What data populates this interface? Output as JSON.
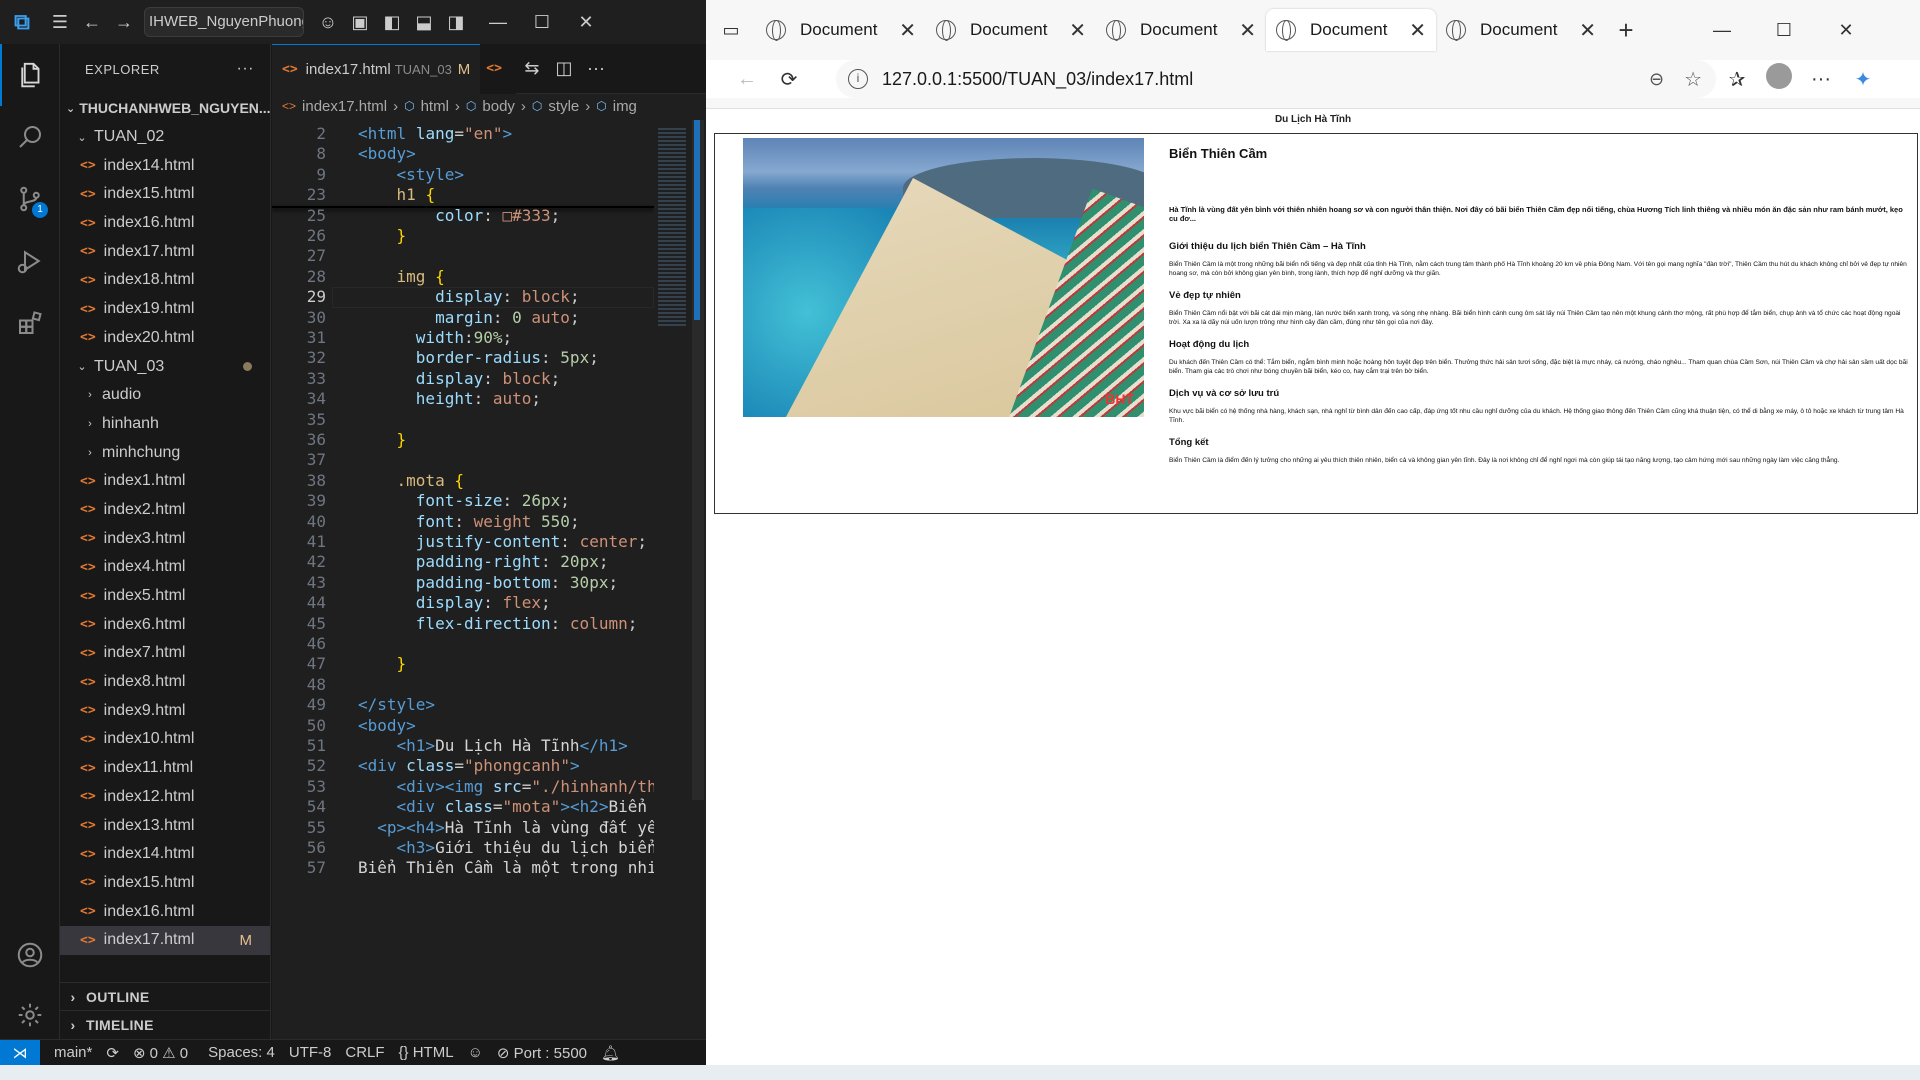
{
  "vscode": {
    "window_title": "IHWEB_NguyenPhuong",
    "explorer_title": "EXPLORER",
    "root_folder": "THUCHANHWEB_NGUYEN...",
    "tree": [
      {
        "label": "TUAN_02",
        "type": "folder",
        "level": 1,
        "open": true
      },
      {
        "label": "index14.html",
        "type": "file",
        "level": 2
      },
      {
        "label": "index15.html",
        "type": "file",
        "level": 2
      },
      {
        "label": "index16.html",
        "type": "file",
        "level": 2
      },
      {
        "label": "index17.html",
        "type": "file",
        "level": 2
      },
      {
        "label": "index18.html",
        "type": "file",
        "level": 2
      },
      {
        "label": "index19.html",
        "type": "file",
        "level": 2
      },
      {
        "label": "index20.html",
        "type": "file",
        "level": 2
      },
      {
        "label": "TUAN_03",
        "type": "folder",
        "level": 1,
        "open": true,
        "dot": true
      },
      {
        "label": "audio",
        "type": "folder",
        "level": 2,
        "open": false
      },
      {
        "label": "hinhanh",
        "type": "folder",
        "level": 2,
        "open": false
      },
      {
        "label": "minhchung",
        "type": "folder",
        "level": 2,
        "open": false
      },
      {
        "label": "index1.html",
        "type": "file",
        "level": 2
      },
      {
        "label": "index2.html",
        "type": "file",
        "level": 2
      },
      {
        "label": "index3.html",
        "type": "file",
        "level": 2
      },
      {
        "label": "index4.html",
        "type": "file",
        "level": 2
      },
      {
        "label": "index5.html",
        "type": "file",
        "level": 2
      },
      {
        "label": "index6.html",
        "type": "file",
        "level": 2
      },
      {
        "label": "index7.html",
        "type": "file",
        "level": 2
      },
      {
        "label": "index8.html",
        "type": "file",
        "level": 2
      },
      {
        "label": "index9.html",
        "type": "file",
        "level": 2
      },
      {
        "label": "index10.html",
        "type": "file",
        "level": 2
      },
      {
        "label": "index11.html",
        "type": "file",
        "level": 2
      },
      {
        "label": "index12.html",
        "type": "file",
        "level": 2
      },
      {
        "label": "index13.html",
        "type": "file",
        "level": 2
      },
      {
        "label": "index14.html",
        "type": "file",
        "level": 2
      },
      {
        "label": "index15.html",
        "type": "file",
        "level": 2
      },
      {
        "label": "index16.html",
        "type": "file",
        "level": 2
      },
      {
        "label": "index17.html",
        "type": "file",
        "level": 2,
        "selected": true,
        "badge": "M"
      }
    ],
    "outline_label": "OUTLINE",
    "timeline_label": "TIMELINE",
    "scm_badge": "1",
    "tab": {
      "name": "index17.html",
      "folder": "TUAN_03",
      "modified": "M"
    },
    "breadcrumb": [
      "index17.html",
      "html",
      "body",
      "style",
      "img"
    ],
    "sticky_lines": [
      {
        "num": "2",
        "html": "<span class='t'>&lt;html</span> <span class='a'>lang</span>=<span class='s'>\"en\"</span><span class='t'>&gt;</span>",
        "indent": 0
      },
      {
        "num": "8",
        "html": "<span class='t'>&lt;body&gt;</span>",
        "indent": 0
      },
      {
        "num": "9",
        "html": "    <span class='t'>&lt;style&gt;</span>",
        "indent": 0
      },
      {
        "num": "23",
        "html": "    <span class='sel2'>h1</span> <span class='br'>{</span>",
        "indent": 0
      }
    ],
    "code_lines": [
      {
        "num": "25",
        "html": "        <span class='p'>color</span>: <span class='v'>□#333</span>;"
      },
      {
        "num": "26",
        "html": "    <span class='br'>}</span>"
      },
      {
        "num": "27",
        "html": ""
      },
      {
        "num": "28",
        "html": "    <span class='sel2'>img</span> <span class='br'>{</span>"
      },
      {
        "num": "29",
        "html": "        <span class='p'>display</span>: <span class='v'>block</span>;",
        "current": true
      },
      {
        "num": "30",
        "html": "        <span class='p'>margin</span>: <span class='n'>0</span> <span class='v'>auto</span>;"
      },
      {
        "num": "31",
        "html": "      <span class='p'>width</span>:<span class='n'>90%</span>;"
      },
      {
        "num": "32",
        "html": "      <span class='p'>border-radius</span>: <span class='n'>5px</span>;"
      },
      {
        "num": "33",
        "html": "      <span class='p'>display</span>: <span class='v'>block</span>;"
      },
      {
        "num": "34",
        "html": "      <span class='p'>height</span>: <span class='v'>auto</span>;"
      },
      {
        "num": "35",
        "html": ""
      },
      {
        "num": "36",
        "html": "    <span class='br'>}</span>"
      },
      {
        "num": "37",
        "html": ""
      },
      {
        "num": "38",
        "html": "    <span class='sel2'>.mota</span> <span class='br'>{</span>"
      },
      {
        "num": "39",
        "html": "      <span class='p'>font-size</span>: <span class='n'>26px</span>;"
      },
      {
        "num": "40",
        "html": "      <span class='p'>font</span>: <span class='v'>weight</span> <span class='n'>550</span>;"
      },
      {
        "num": "41",
        "html": "      <span class='p'>justify-content</span>: <span class='v'>center</span>;"
      },
      {
        "num": "42",
        "html": "      <span class='p'>padding-right</span>: <span class='n'>20px</span>;"
      },
      {
        "num": "43",
        "html": "      <span class='p'>padding-bottom</span>: <span class='n'>30px</span>;"
      },
      {
        "num": "44",
        "html": "      <span class='p'>display</span>: <span class='v'>flex</span>;"
      },
      {
        "num": "45",
        "html": "      <span class='p'>flex-direction</span>: <span class='v'>column</span>;"
      },
      {
        "num": "46",
        "html": ""
      },
      {
        "num": "47",
        "html": "    <span class='br'>}</span>"
      },
      {
        "num": "48",
        "html": ""
      },
      {
        "num": "49",
        "html": "<span class='t'>&lt;/style&gt;</span>"
      },
      {
        "num": "50",
        "html": "<span class='t'>&lt;body&gt;</span>"
      },
      {
        "num": "51",
        "html": "    <span class='t'>&lt;h1&gt;</span><span class='txt'>Du Lịch Hà Tĩnh</span><span class='t'>&lt;/h1&gt;</span>"
      },
      {
        "num": "52",
        "html": "<span class='t'>&lt;div</span> <span class='a'>class</span>=<span class='s'>\"phongcanh\"</span><span class='t'>&gt;</span>"
      },
      {
        "num": "53",
        "html": "    <span class='t'>&lt;div&gt;&lt;img</span> <span class='a'>src</span>=<span class='s'>\"./hinhanh/th</span>"
      },
      {
        "num": "54",
        "html": "    <span class='t'>&lt;div</span> <span class='a'>class</span>=<span class='s'>\"mota\"</span><span class='t'>&gt;&lt;h2&gt;</span><span class='txt'>Biển</span>"
      },
      {
        "num": "55",
        "html": "  <span class='t'>&lt;p&gt;&lt;h4&gt;</span><span class='txt'>Hà Tĩnh là vùng đất yê</span>"
      },
      {
        "num": "56",
        "html": "    <span class='t'>&lt;h3&gt;</span><span class='txt'>Giới thiệu du lịch biển</span>"
      },
      {
        "num": "57",
        "html": "<span class='txt'>Biển Thiên Cầm là một trong nhi</span>"
      }
    ],
    "status": {
      "branch": "main*",
      "problems": "⊗ 0 ⚠ 0",
      "spaces": "Spaces: 4",
      "encoding": "UTF-8",
      "eol": "CRLF",
      "language": "{} HTML",
      "port": "⊘ Port : 5500"
    }
  },
  "browser": {
    "tabs": [
      {
        "label": "Document",
        "active": false
      },
      {
        "label": "Document",
        "active": false
      },
      {
        "label": "Document",
        "active": false
      },
      {
        "label": "Document",
        "active": true
      },
      {
        "label": "Document",
        "active": false
      }
    ],
    "url": "127.0.0.1:5500/TUAN_03/index17.html",
    "page": {
      "h1": "Du Lịch Hà Tĩnh",
      "h2": "Biển Thiên Cầm",
      "intro": "Hà Tĩnh là vùng đất yên bình với thiên nhiên hoang sơ và con người thân thiện. Nơi đây có bãi biển Thiên Cầm đẹp nổi tiếng, chùa Hương Tích linh thiêng và nhiều món ăn đặc sản như ram bánh mướt, kẹo cu đơ...",
      "photo_logo": "BHT",
      "sections": [
        {
          "title": "Giới thiệu du lịch biển Thiên Cầm – Hà Tĩnh",
          "text": "Biển Thiên Cầm là một trong những bãi biển nổi tiếng và đẹp nhất của tỉnh Hà Tĩnh, nằm cách trung tâm thành phố Hà Tĩnh khoảng 20 km về phía Đông Nam. Với tên gọi mang nghĩa \"đàn trời\", Thiên Cầm thu hút du khách không chỉ bởi vẻ đẹp tự nhiên hoang sơ, mà còn bởi không gian yên bình, trong lành, thích hợp để nghỉ dưỡng và thư giãn."
        },
        {
          "title": "Vẻ đẹp tự nhiên",
          "text": "Biển Thiên Cầm nổi bật với bãi cát dài mịn màng, làn nước biển xanh trong, và sóng nhẹ nhàng. Bãi biển hình cánh cung ôm sát lấy núi Thiên Cầm tạo nên một khung cảnh thơ mộng, rất phù hợp để tắm biển, chụp ảnh và tổ chức các hoạt động ngoài trời. Xa xa là dãy núi uốn lượn trông như hình cây đàn cầm, đúng như tên gọi của nơi đây."
        },
        {
          "title": "Hoạt động du lịch",
          "text": "Du khách đến Thiên Cầm có thể: Tắm biển, ngắm bình minh hoặc hoàng hôn tuyệt đẹp trên biển. Thưởng thức hải sản tươi sống, đặc biệt là mực nháy, cá nướng, cháo nghêu... Tham quan chùa Cầm Sơn, núi Thiên Cầm và chợ hải sản sầm uất dọc bãi biển. Tham gia các trò chơi như bóng chuyền bãi biển, kéo co, hay cắm trại trên bờ biển."
        },
        {
          "title": "Dịch vụ và cơ sở lưu trú",
          "text": "Khu vực bãi biển có hệ thống nhà hàng, khách sạn, nhà nghỉ từ bình dân đến cao cấp, đáp ứng tốt nhu cầu nghỉ dưỡng của du khách. Hệ thống giao thông đến Thiên Cầm cũng khá thuận tiện, có thể di bằng xe máy, ô tô hoặc xe khách từ trung tâm Hà Tĩnh."
        },
        {
          "title": "Tổng kết",
          "text": "Biển Thiên Cầm là điểm đến lý tưởng cho những ai yêu thích thiên nhiên, biển cả và không gian yên tĩnh. Đây là nơi không chỉ để nghỉ ngơi mà còn giúp tái tạo năng lượng, tạo cảm hứng mới sau những ngày làm việc căng thẳng."
        }
      ]
    }
  }
}
